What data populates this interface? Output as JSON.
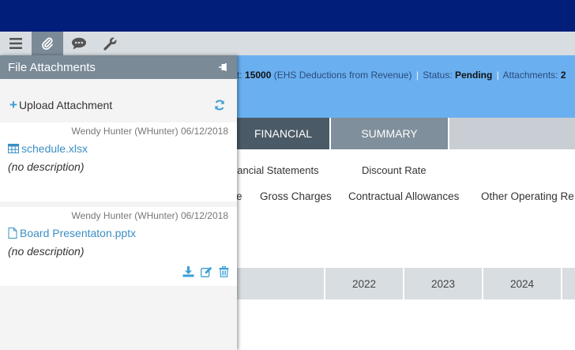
{
  "toolbar": {
    "items": [
      {
        "icon": "menu-icon"
      },
      {
        "icon": "paperclip-icon",
        "active": true
      },
      {
        "icon": "comments-icon"
      },
      {
        "icon": "wrench-icon"
      }
    ]
  },
  "info_bar": {
    "amount_prefix": "t:",
    "amount": "15000",
    "amount_note": "(EHS Deductions from Revenue)",
    "status_label": "Status:",
    "status_value": "Pending",
    "attachments_label": "Attachments:",
    "attachments_value": "2"
  },
  "tabs": [
    {
      "label": "FINANCIAL",
      "state": "active"
    },
    {
      "label": "SUMMARY",
      "state": "inactive"
    }
  ],
  "subtabs": [
    "nancial Statements",
    "Discount Rate"
  ],
  "line_items": [
    "e",
    "Gross Charges",
    "Contractual Allowances",
    "Other Operating Re"
  ],
  "years": [
    "2022",
    "2023",
    "2024"
  ],
  "panel": {
    "title": "File Attachments",
    "upload_label": "Upload Attachment",
    "attachments": [
      {
        "author": "Wendy Hunter (WHunter) 06/12/2018",
        "filename": "schedule.xlsx",
        "file_icon": "table-icon",
        "description": "(no description)"
      },
      {
        "author": "Wendy Hunter (WHunter) 06/12/2018",
        "filename": "Board Presentaton.pptx",
        "file_icon": "file-icon",
        "description": "(no description)"
      }
    ]
  },
  "colors": {
    "topbar": "#001e7a",
    "info_bar": "#6ab0f0",
    "accent": "#3b9fd6",
    "panel_header": "#7a8a97"
  }
}
